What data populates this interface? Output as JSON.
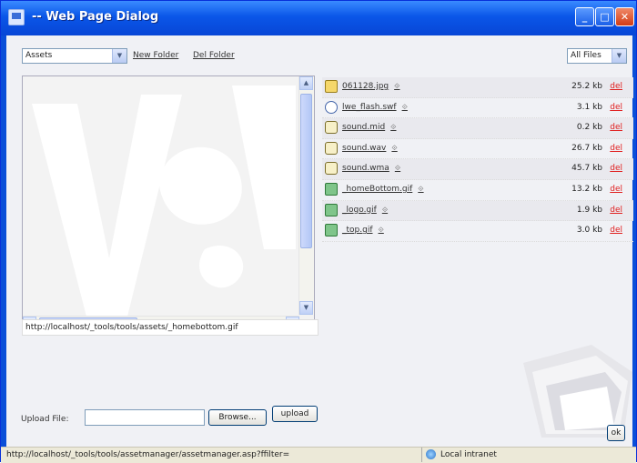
{
  "window": {
    "title": "-- Web Page Dialog"
  },
  "toolbar": {
    "folder_select": "Assets",
    "new_folder": "New Folder",
    "del_folder": "Del Folder",
    "filter_select": "All Files"
  },
  "preview": {
    "path": "http://localhost/_tools/tools/assets/_homebottom.gif"
  },
  "files": [
    {
      "name": "061128.jpg",
      "size": "25.2 kb",
      "del": "del",
      "icon": "jpg-file-icon"
    },
    {
      "name": "lwe_flash.swf",
      "size": "3.1 kb",
      "del": "del",
      "icon": "flash-file-icon"
    },
    {
      "name": "sound.mid",
      "size": "0.2 kb",
      "del": "del",
      "icon": "sound-file-icon"
    },
    {
      "name": "sound.wav",
      "size": "26.7 kb",
      "del": "del",
      "icon": "sound-file-icon"
    },
    {
      "name": "sound.wma",
      "size": "45.7 kb",
      "del": "del",
      "icon": "sound-file-icon"
    },
    {
      "name": "_homeBottom.gif",
      "size": "13.2 kb",
      "del": "del",
      "icon": "gif-file-icon"
    },
    {
      "name": "_logo.gif",
      "size": "1.9 kb",
      "del": "del",
      "icon": "gif-file-icon"
    },
    {
      "name": "_top.gif",
      "size": "3.0 kb",
      "del": "del",
      "icon": "gif-file-icon"
    }
  ],
  "upload": {
    "label": "Upload File:",
    "browse": "Browse...",
    "upload_button": "upload"
  },
  "footer": {
    "ok": "ok"
  },
  "statusbar": {
    "url": "http://localhost/_tools/tools/assetmanager/assetmanager.asp?ffilter=",
    "zone": "Local intranet"
  },
  "colors": {
    "titlebar": "#0a56e8",
    "delete_link": "#e02020",
    "client_bg": "#f0f1f5"
  }
}
